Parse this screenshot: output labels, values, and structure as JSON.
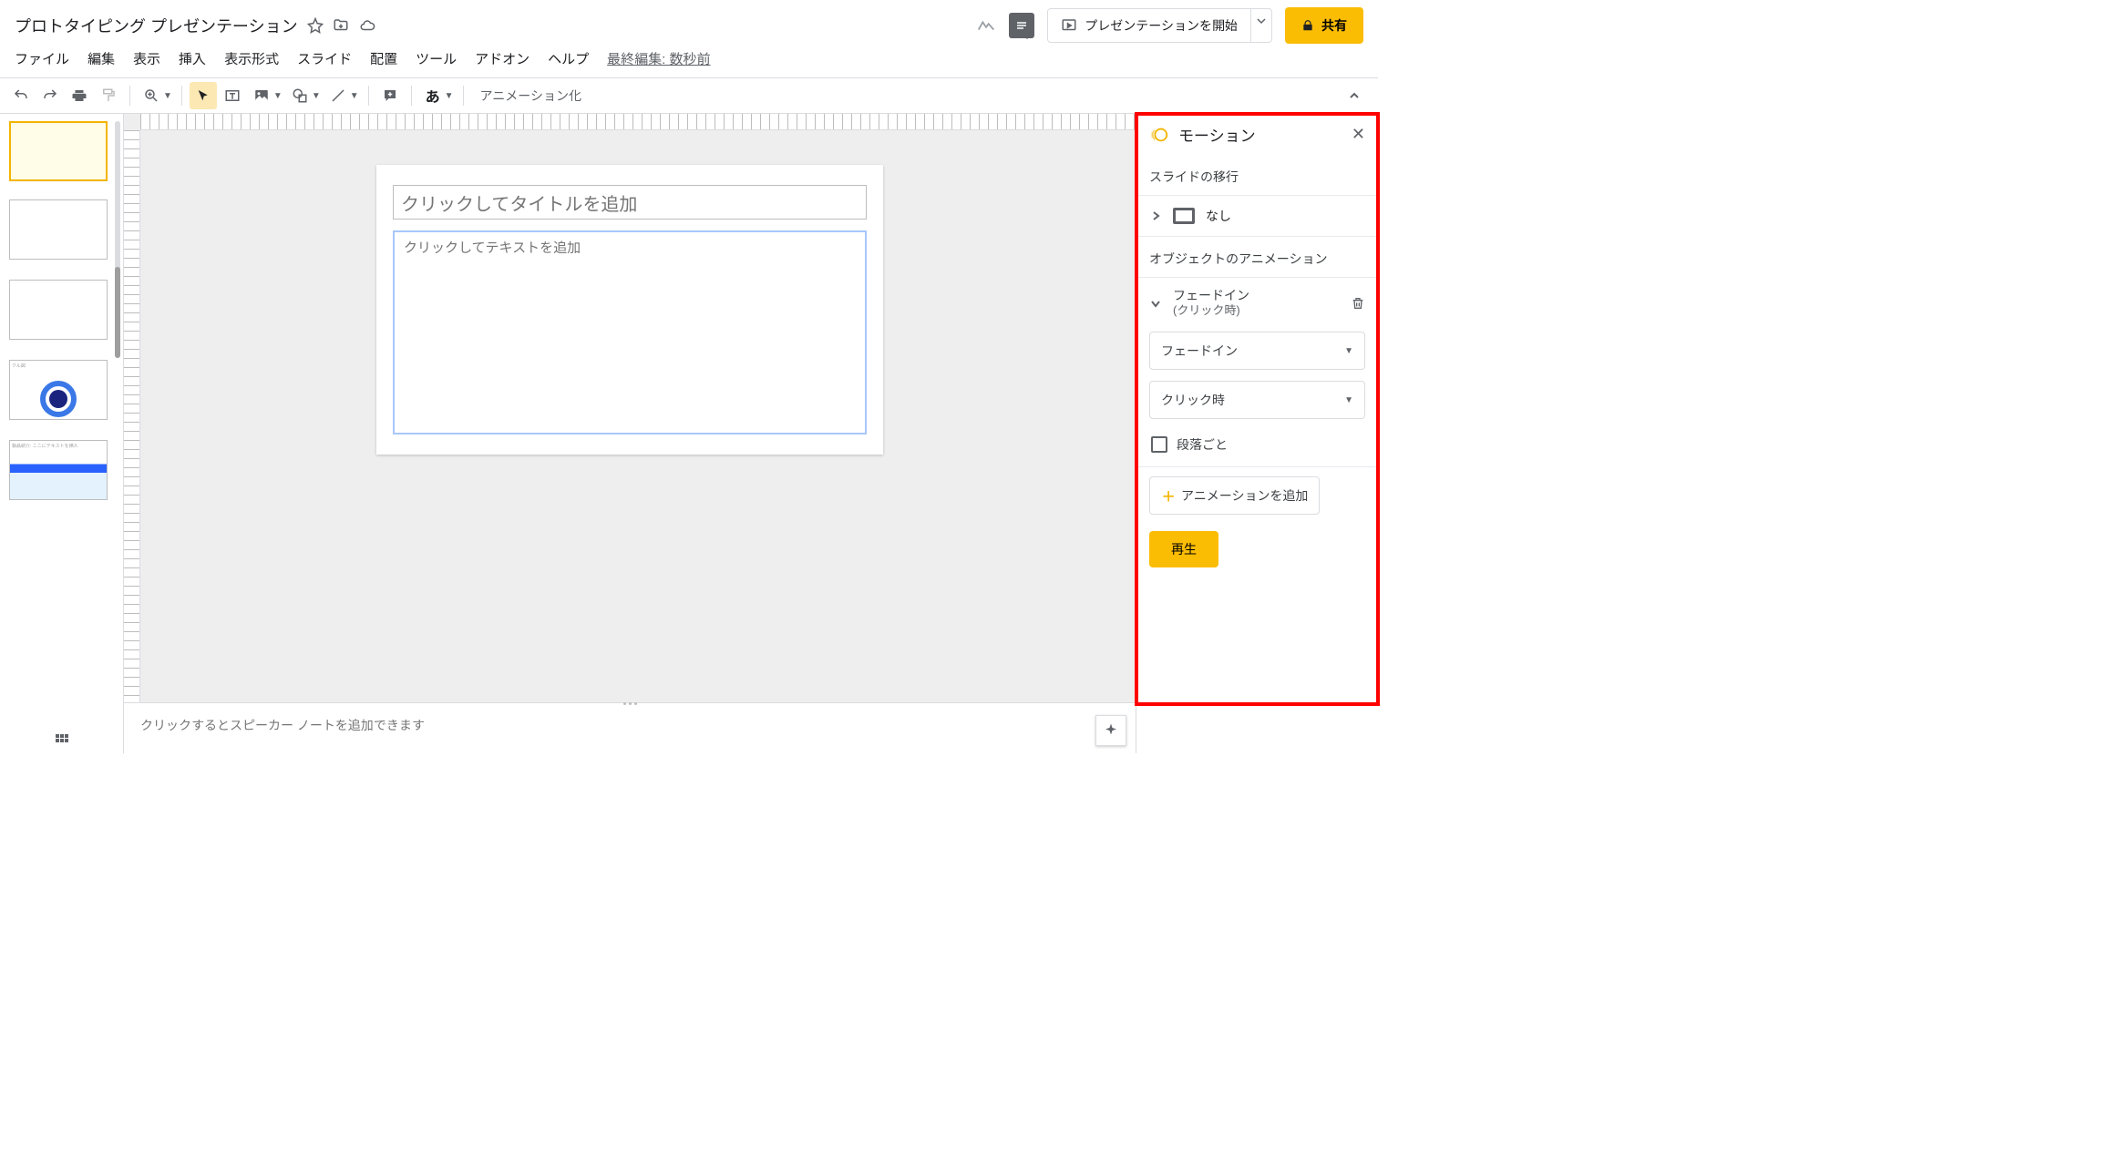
{
  "title": "プロトタイピング プレゼンテーション",
  "menu": {
    "file": "ファイル",
    "edit": "編集",
    "view": "表示",
    "insert": "挿入",
    "format": "表示形式",
    "slide": "スライド",
    "arrange": "配置",
    "tools": "ツール",
    "addons": "アドオン",
    "help": "ヘルプ",
    "last_edit": "最終編集: 数秒前"
  },
  "toolbar": {
    "animation_label": "アニメーション化",
    "input_lang": "あ"
  },
  "header_buttons": {
    "present": "プレゼンテーションを開始",
    "share": "共有"
  },
  "slide_canvas": {
    "title_placeholder": "クリックしてタイトルを追加",
    "body_placeholder": "クリックしてテキストを追加"
  },
  "notes_placeholder": "クリックするとスピーカー ノートを追加できます",
  "filmstrip": {
    "thumb4_label": "クル図",
    "thumb5_title": "製品紹介: ここにテキストを挿入"
  },
  "motion_panel": {
    "title": "モーション",
    "slide_transition_label": "スライドの移行",
    "transition_value": "なし",
    "object_anim_label": "オブジェクトのアニメーション",
    "anim_name": "フェードイン",
    "anim_trigger_sub": "(クリック時)",
    "anim_type_dd": "フェードイン",
    "trigger_dd": "クリック時",
    "by_paragraph": "段落ごと",
    "add_animation": "アニメーションを追加",
    "play": "再生"
  }
}
